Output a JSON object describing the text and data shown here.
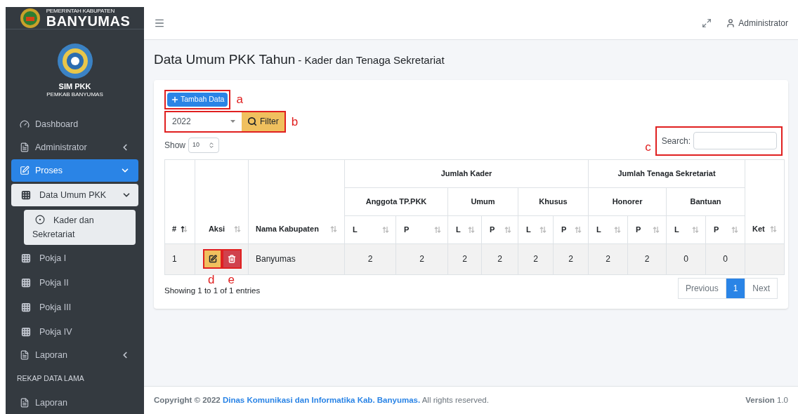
{
  "brand": {
    "line_1": "PEMERINTAH KABUPATEN",
    "line_2": "BANYUMAS"
  },
  "app_logo": {
    "title": "SIM PKK",
    "subtitle": "PEMKAB BANYUMAS"
  },
  "sidebar": [
    {
      "kind": "item",
      "label": "Dashboard",
      "selected": false
    },
    {
      "kind": "item",
      "label": "Administrator",
      "selected": false,
      "expanded": false
    },
    {
      "kind": "item",
      "label": "Proses",
      "selected": true,
      "expanded": true,
      "children": [
        {
          "label": "Data Umum PKK",
          "selected": true,
          "expanded": true,
          "children": [
            {
              "label": "Kader dan Sekretariat",
              "selected": true
            }
          ]
        },
        {
          "label": "Pokja I",
          "selected": false
        },
        {
          "label": "Pokja II",
          "selected": false
        },
        {
          "label": "Pokja III",
          "selected": false
        },
        {
          "label": "Pokja IV",
          "selected": false
        }
      ]
    },
    {
      "kind": "item",
      "label": "Laporan",
      "selected": false,
      "expanded": false
    },
    {
      "kind": "header",
      "label": "REKAP DATA LAMA"
    },
    {
      "kind": "item",
      "label": "Laporan",
      "selected": false
    }
  ],
  "topbar": {
    "user": "Administrator"
  },
  "page": {
    "title": "Data Umum PKK Tahun",
    "subtitle": "- Kader dan Tenaga Sekretariat"
  },
  "add_button": {
    "label": "Tambah Data",
    "annotation": "a"
  },
  "filter": {
    "value": "2022",
    "button": "Filter",
    "annotation": "b"
  },
  "show": {
    "label": "Show",
    "value": "10"
  },
  "search": {
    "label": "Search:",
    "annotation": "c"
  },
  "table": {
    "groups": [
      {
        "label": "Jumlah Kader",
        "subgroups": [
          "Anggota TP.PKK",
          "Umum",
          "Khusus"
        ]
      },
      {
        "label": "Jumlah Tenaga Sekretariat",
        "subgroups": [
          "Honorer",
          "Bantuan"
        ]
      }
    ],
    "columns": [
      {
        "label": "#",
        "sorted": true
      },
      {
        "label": "Aksi",
        "sorted": false
      },
      {
        "label": "Nama Kabupaten",
        "sorted": false
      },
      {
        "label": "L",
        "sorted": false
      },
      {
        "label": "P",
        "sorted": false
      },
      {
        "label": "L",
        "sorted": false
      },
      {
        "label": "P",
        "sorted": false
      },
      {
        "label": "L",
        "sorted": false
      },
      {
        "label": "P",
        "sorted": false
      },
      {
        "label": "L",
        "sorted": false
      },
      {
        "label": "P",
        "sorted": false
      },
      {
        "label": "L",
        "sorted": false
      },
      {
        "label": "P",
        "sorted": false
      },
      {
        "label": "Ket",
        "sorted": false
      }
    ],
    "rows": [
      {
        "no": "1",
        "edit_annotation": "d",
        "delete_annotation": "e",
        "name": "Banyumas",
        "values": [
          "2",
          "2",
          "2",
          "2",
          "2",
          "2",
          "2",
          "2",
          "0",
          "0"
        ]
      }
    ]
  },
  "info": "Showing 1 to 1 of 1 entries",
  "pagination": [
    {
      "label": "Previous",
      "selected": false
    },
    {
      "label": "1",
      "selected": true
    },
    {
      "label": "Next",
      "selected": false
    }
  ],
  "footer": {
    "prefix": "Copyright © 2022",
    "link": "Dinas Komunikasi dan Informatika Kab. Banyumas.",
    "suffix": "All rights reserved.",
    "version_label": "Version",
    "version": "1.0"
  }
}
